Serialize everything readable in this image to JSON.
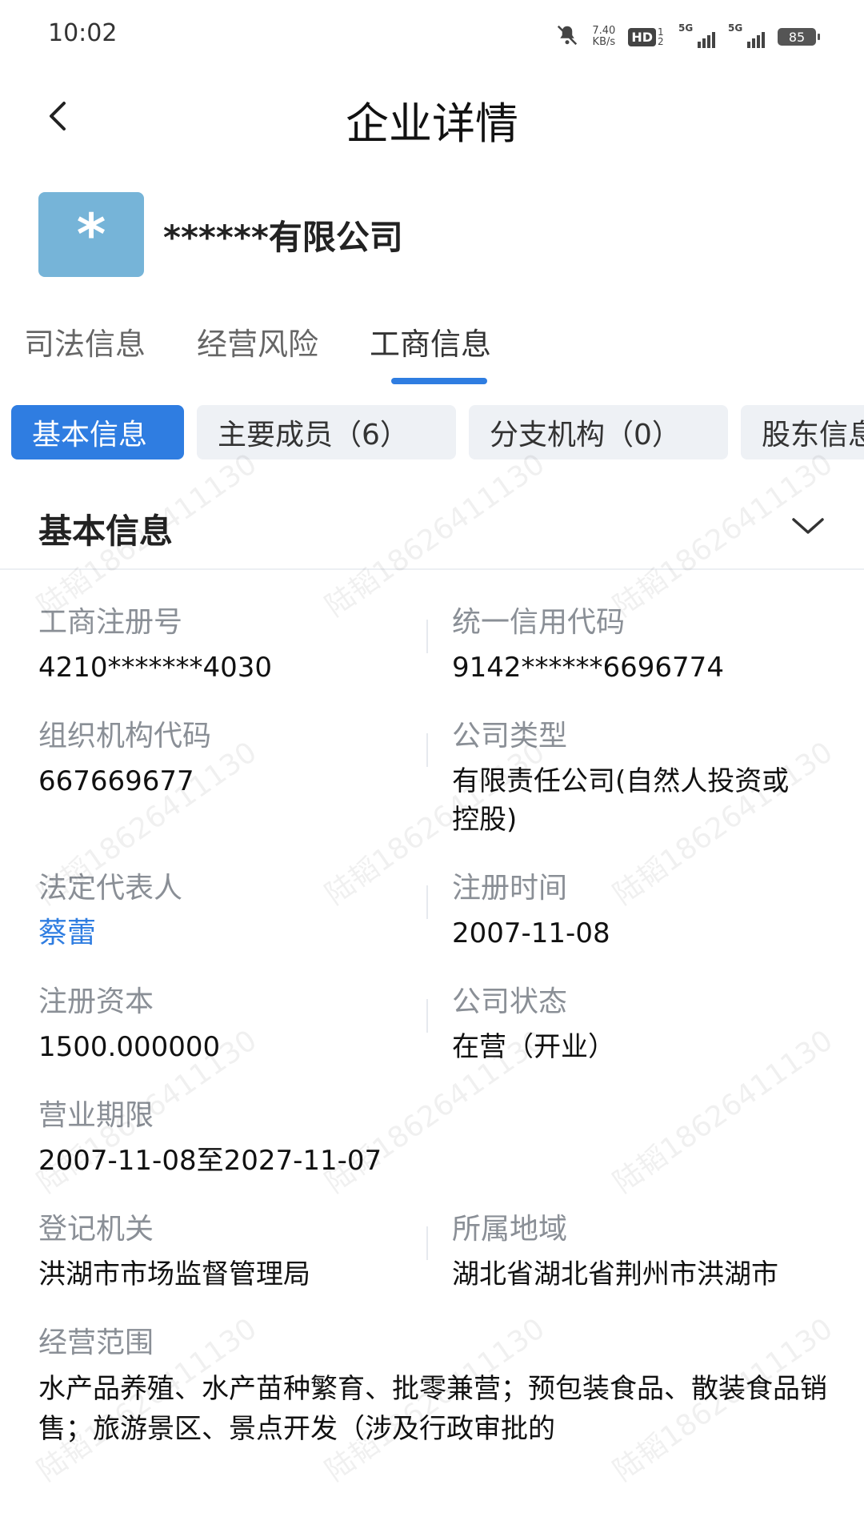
{
  "status": {
    "time": "10:02",
    "net_speed_value": "7.40",
    "net_speed_unit": "KB/s",
    "hd": "HD",
    "hd_sub": "1 2",
    "signal1_label": "5G",
    "signal2_label": "5G",
    "battery": "85"
  },
  "header": {
    "title": "企业详情"
  },
  "company": {
    "logo_text": "*",
    "name": "******有限公司"
  },
  "tabs": [
    {
      "label": "司法信息"
    },
    {
      "label": "经营风险"
    },
    {
      "label": "工商信息"
    }
  ],
  "chips": [
    {
      "label": "基本信息"
    },
    {
      "label": "主要成员（6）"
    },
    {
      "label": "分支机构（0）"
    },
    {
      "label": "股东信息"
    }
  ],
  "section": {
    "title": "基本信息"
  },
  "fields": {
    "reg_no_label": "工商注册号",
    "reg_no": "4210*******4030",
    "credit_code_label": "统一信用代码",
    "credit_code": "9142******6696774",
    "org_code_label": "组织机构代码",
    "org_code": "667669677",
    "company_type_label": "公司类型",
    "company_type": "有限责任公司(自然人投资或控股)",
    "legal_rep_label": "法定代表人",
    "legal_rep": "蔡蕾",
    "reg_date_label": "注册时间",
    "reg_date": "2007-11-08",
    "capital_label": "注册资本",
    "capital": "1500.000000",
    "status_label": "公司状态",
    "status": "在营（开业）",
    "term_label": "营业期限",
    "term": "2007-11-08至2027-11-07",
    "authority_label": "登记机关",
    "authority": "洪湖市市场监督管理局",
    "region_label": "所属地域",
    "region": "湖北省湖北省荆州市洪湖市",
    "scope_label": "经营范围",
    "scope": "水产品养殖、水产苗种繁育、批零兼营；预包装食品、散装食品销售；旅游景区、景点开发（涉及行政审批的"
  },
  "watermark": "陆韬18626411130",
  "colors": {
    "accent": "#2f7de1",
    "logo_bg": "#76b4d8"
  }
}
